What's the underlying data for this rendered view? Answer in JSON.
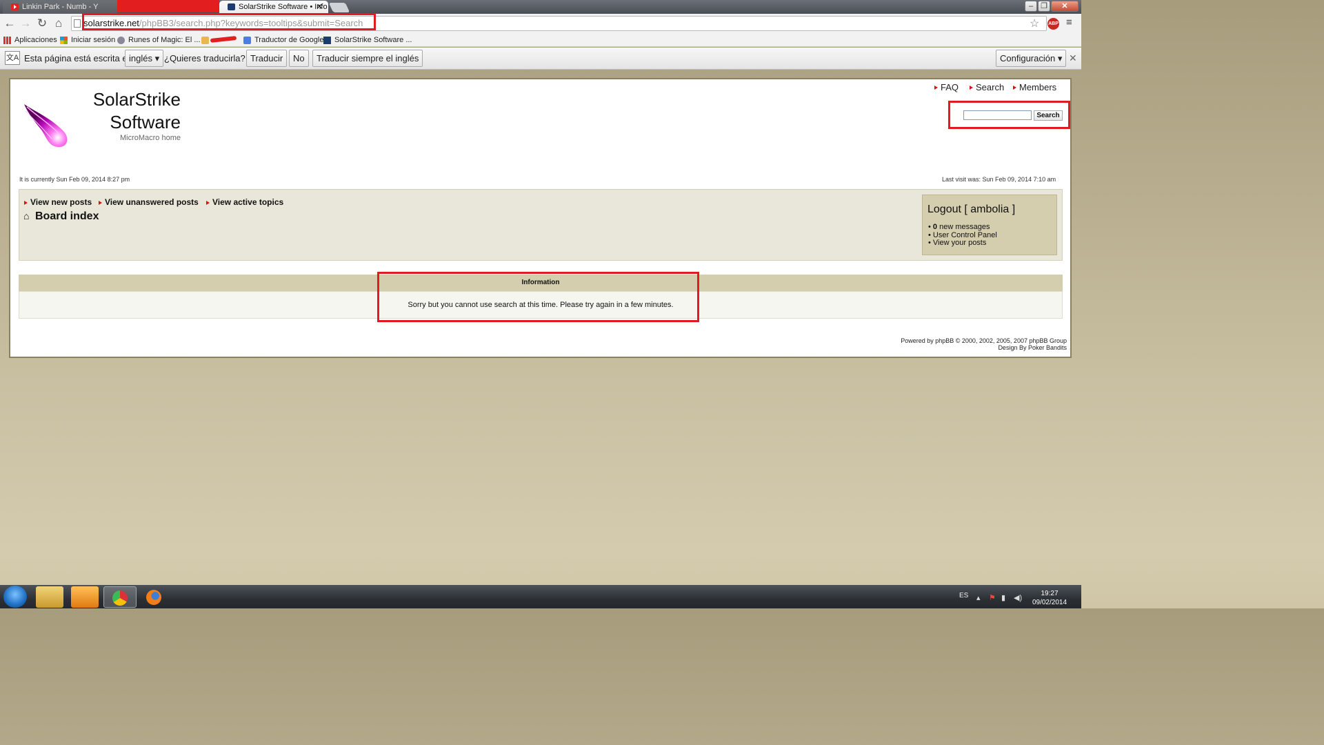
{
  "browser": {
    "tabs": [
      {
        "label": "Linkin Park - Numb - Y",
        "active": false
      },
      {
        "label": "SolarStrike Software • Info",
        "active": true
      }
    ],
    "url_host": "solarstrike.net",
    "url_path": "/phpBB3/search.php?keywords=tooltips&submit=Search",
    "abp_label": "ABP",
    "bookmarks": [
      {
        "label": "Aplicaciones",
        "icon": "apps-grid-icon"
      },
      {
        "label": "Iniciar sesión",
        "icon": "microsoft-icon"
      },
      {
        "label": "Runes of Magic: El ...",
        "icon": "runes-icon"
      },
      {
        "label": "Traductor de Google",
        "icon": "translate-icon"
      },
      {
        "label": "SolarStrike Software ...",
        "icon": "solarstrike-icon"
      }
    ]
  },
  "translate_bar": {
    "icon_text": "文A",
    "prefix": "Esta página está escrita en",
    "language": "inglés",
    "question": "¿Quieres traducirla?",
    "translate": "Traducir",
    "no": "No",
    "always": "Traducir siempre el inglés",
    "settings": "Configuración"
  },
  "forum": {
    "title_line1": "SolarStrike",
    "title_line2": "Software",
    "description": "MicroMacro home",
    "top_links": [
      "FAQ",
      "Search",
      "Members"
    ],
    "search_button": "Search",
    "current_time": "It is currently Sun Feb 09, 2014 8:27 pm",
    "last_visit": "Last visit was: Sun Feb 09, 2014 7:10 am",
    "nav_links": [
      "View new posts",
      "View unanswered posts",
      "View active topics"
    ],
    "board_index": "Board index",
    "user": {
      "logout": "Logout [ ambolia ]",
      "new_count": "0",
      "new_messages": " new messages",
      "ucp": "User Control Panel",
      "your_posts": "View your posts"
    },
    "info_title": "Information",
    "info_message": "Sorry but you cannot use search at this time. Please try again in a few minutes.",
    "credit1": "Powered by phpBB © 2000, 2002, 2005, 2007 phpBB Group",
    "credit2": "Design By Poker Bandits"
  },
  "taskbar": {
    "lang": "ES",
    "time": "19:27",
    "date": "09/02/2014"
  },
  "colors": {
    "highlight_red": "#e01b24",
    "panel_tan": "#d4cdae",
    "nav_panel": "#e8e7d9"
  }
}
